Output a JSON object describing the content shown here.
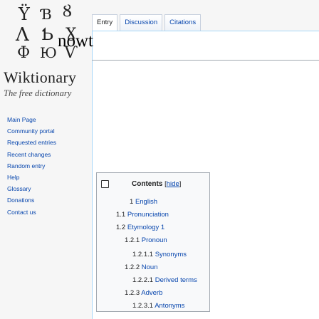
{
  "site": {
    "name": "Wiktionary",
    "tagline": "The free dictionary"
  },
  "logo_glyphs": [
    "Ÿ",
    "Ɓ",
    "Ȣ",
    "Ʌ",
    "Ƅ",
    "Ɣ",
    "Ф",
    "Ю",
    "Ѵ"
  ],
  "sidebar": {
    "items": [
      {
        "label": "Main Page"
      },
      {
        "label": "Community portal"
      },
      {
        "label": "Requested entries"
      },
      {
        "label": "Recent changes"
      },
      {
        "label": "Random entry"
      },
      {
        "label": "Help"
      },
      {
        "label": "Glossary"
      },
      {
        "label": "Donations"
      },
      {
        "label": "Contact us"
      }
    ]
  },
  "tabs": [
    {
      "label": "Entry"
    },
    {
      "label": "Discussion"
    },
    {
      "label": "Citations"
    }
  ],
  "page": {
    "title": "nowt"
  },
  "toc": {
    "title": "Contents",
    "hide_open": "[",
    "hide_label": "hide",
    "hide_close": "]",
    "items": [
      {
        "num": "1",
        "text": "English"
      },
      {
        "num": "1.1",
        "text": "Pronunciation"
      },
      {
        "num": "1.2",
        "text": "Etymology 1"
      },
      {
        "num": "1.2.1",
        "text": "Pronoun"
      },
      {
        "num": "1.2.1.1",
        "text": "Synonyms"
      },
      {
        "num": "1.2.2",
        "text": "Noun"
      },
      {
        "num": "1.2.2.1",
        "text": "Derived terms"
      },
      {
        "num": "1.2.3",
        "text": "Adverb"
      },
      {
        "num": "1.2.3.1",
        "text": "Antonyms"
      }
    ]
  }
}
